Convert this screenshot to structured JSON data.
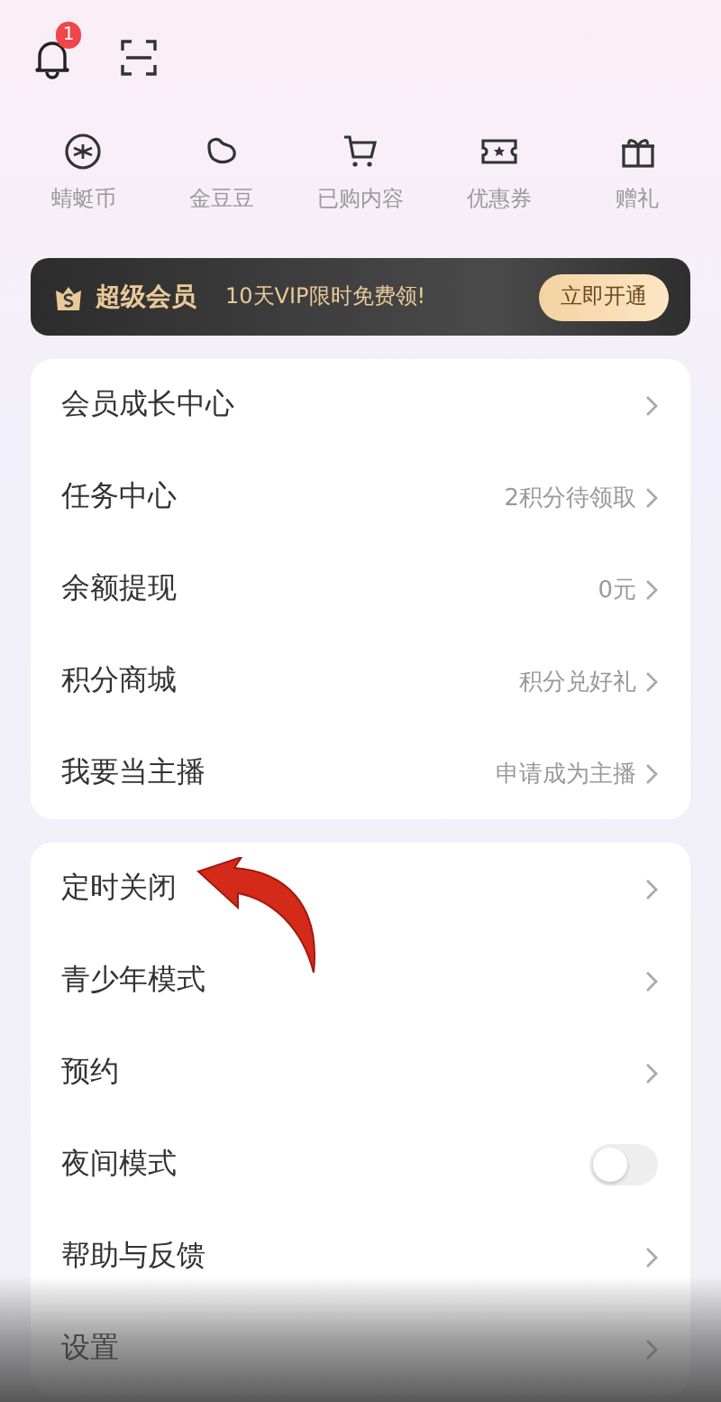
{
  "top_bar": {
    "notification_badge": "1"
  },
  "shortcuts": [
    {
      "label": "蜻蜓币",
      "kind": "coin"
    },
    {
      "label": "金豆豆",
      "kind": "bean"
    },
    {
      "label": "已购内容",
      "kind": "cart"
    },
    {
      "label": "优惠券",
      "kind": "ticket"
    },
    {
      "label": "赠礼",
      "kind": "gift"
    }
  ],
  "vip_banner": {
    "title": "超级会员",
    "promo": "10天VIP限时免费领!",
    "button": "立即开通"
  },
  "menu_group_1": [
    {
      "label": "会员成长中心",
      "kind": "link"
    },
    {
      "label": "任务中心",
      "value": "2积分待领取",
      "kind": "link"
    },
    {
      "label": "余额提现",
      "value": "0元",
      "kind": "link"
    },
    {
      "label": "积分商城",
      "value": "积分兑好礼",
      "kind": "link"
    },
    {
      "label": "我要当主播",
      "value": "申请成为主播",
      "kind": "link"
    }
  ],
  "menu_group_2": [
    {
      "label": "定时关闭",
      "kind": "link"
    },
    {
      "label": "青少年模式",
      "kind": "link"
    },
    {
      "label": "预约",
      "kind": "link"
    },
    {
      "label": "夜间模式",
      "kind": "toggle",
      "on": false
    },
    {
      "label": "帮助与反馈",
      "kind": "link"
    },
    {
      "label": "设置",
      "kind": "link"
    }
  ]
}
